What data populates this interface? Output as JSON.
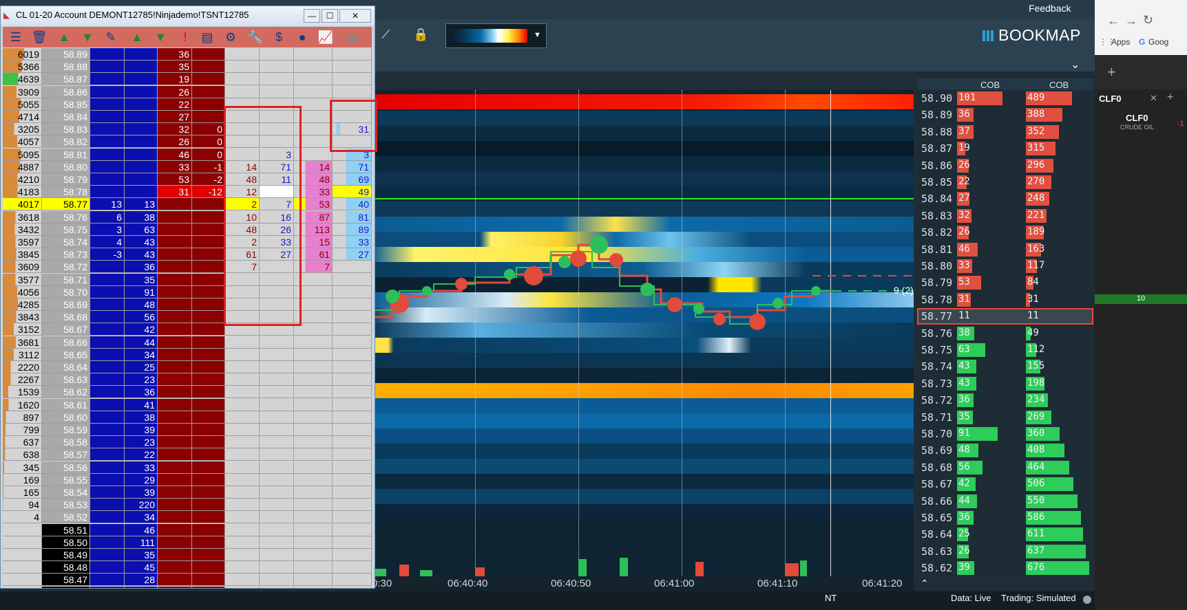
{
  "bookmap": {
    "feedback": "Feedback",
    "logo": "BOOKMAP",
    "cob_headers": [
      "COB",
      "COB"
    ],
    "time_labels": [
      "0:30",
      "06:40:40",
      "06:40:50",
      "06:41:00",
      "06:41:10",
      "06:41:20"
    ],
    "nt_label": "NT",
    "status_data": "Data: Live",
    "status_trading": "Trading: Simulated",
    "marker_text": "9 (2)",
    "current_price": "58.77",
    "ladder": [
      {
        "price": "58.90",
        "v1": "101",
        "v2": "489",
        "side": "ask"
      },
      {
        "price": "58.89",
        "v1": "36",
        "v2": "388",
        "side": "ask"
      },
      {
        "price": "58.88",
        "v1": "37",
        "v2": "352",
        "side": "ask"
      },
      {
        "price": "58.87",
        "v1": "19",
        "v2": "315",
        "side": "ask"
      },
      {
        "price": "58.86",
        "v1": "26",
        "v2": "296",
        "side": "ask"
      },
      {
        "price": "58.85",
        "v1": "22",
        "v2": "270",
        "side": "ask"
      },
      {
        "price": "58.84",
        "v1": "27",
        "v2": "248",
        "side": "ask"
      },
      {
        "price": "58.83",
        "v1": "32",
        "v2": "221",
        "side": "ask"
      },
      {
        "price": "58.82",
        "v1": "26",
        "v2": "189",
        "side": "ask"
      },
      {
        "price": "58.81",
        "v1": "46",
        "v2": "163",
        "side": "ask"
      },
      {
        "price": "58.80",
        "v1": "33",
        "v2": "117",
        "side": "ask"
      },
      {
        "price": "58.79",
        "v1": "53",
        "v2": "84",
        "side": "ask"
      },
      {
        "price": "58.78",
        "v1": "31",
        "v2": "31",
        "side": "ask"
      },
      {
        "price": "58.77",
        "v1": "11",
        "v2": "11",
        "side": "mid"
      },
      {
        "price": "58.76",
        "v1": "38",
        "v2": "49",
        "side": "bid"
      },
      {
        "price": "58.75",
        "v1": "63",
        "v2": "112",
        "side": "bid"
      },
      {
        "price": "58.74",
        "v1": "43",
        "v2": "155",
        "side": "bid"
      },
      {
        "price": "58.73",
        "v1": "43",
        "v2": "198",
        "side": "bid"
      },
      {
        "price": "58.72",
        "v1": "36",
        "v2": "234",
        "side": "bid"
      },
      {
        "price": "58.71",
        "v1": "35",
        "v2": "269",
        "side": "bid"
      },
      {
        "price": "58.70",
        "v1": "91",
        "v2": "360",
        "side": "bid"
      },
      {
        "price": "58.69",
        "v1": "48",
        "v2": "408",
        "side": "bid"
      },
      {
        "price": "58.68",
        "v1": "56",
        "v2": "464",
        "side": "bid"
      },
      {
        "price": "58.67",
        "v1": "42",
        "v2": "506",
        "side": "bid"
      },
      {
        "price": "58.66",
        "v1": "44",
        "v2": "550",
        "side": "bid"
      },
      {
        "price": "58.65",
        "v1": "36",
        "v2": "586",
        "side": "bid"
      },
      {
        "price": "58.64",
        "v1": "25",
        "v2": "611",
        "side": "bid"
      },
      {
        "price": "58.63",
        "v1": "26",
        "v2": "637",
        "side": "bid"
      },
      {
        "price": "58.62",
        "v1": "39",
        "v2": "676",
        "side": "bid"
      }
    ]
  },
  "browser": {
    "apps": "Apps",
    "google": "Goog",
    "tab_name": "CLF0",
    "symbol": "CLF0",
    "symbol_sub": "CRUDE OIL",
    "badge": "10",
    "change": "-1"
  },
  "nt": {
    "title": "CL 01-20  Account DEMONT12785!Ninjademo!TSNT12785",
    "rows": [
      {
        "v": "6019",
        "p": "58.89",
        "b1": "",
        "b2": "",
        "a1": "36",
        "a2": "",
        "x1": "",
        "x2": "",
        "x3": "",
        "x4": ""
      },
      {
        "v": "5366",
        "p": "58.88",
        "b1": "",
        "b2": "",
        "a1": "35",
        "a2": "",
        "x1": "",
        "x2": "",
        "x3": "",
        "x4": ""
      },
      {
        "v": "4639",
        "p": "58.87",
        "b1": "",
        "b2": "",
        "a1": "19",
        "a2": "",
        "x1": "",
        "x2": "",
        "x3": "",
        "x4": ""
      },
      {
        "v": "3909",
        "p": "58.86",
        "b1": "",
        "b2": "",
        "a1": "26",
        "a2": "",
        "x1": "",
        "x2": "",
        "x3": "",
        "x4": ""
      },
      {
        "v": "5055",
        "p": "58.85",
        "b1": "",
        "b2": "",
        "a1": "22",
        "a2": "",
        "x1": "",
        "x2": "",
        "x3": "",
        "x4": ""
      },
      {
        "v": "4714",
        "p": "58.84",
        "b1": "",
        "b2": "",
        "a1": "27",
        "a2": "",
        "x1": "",
        "x2": "",
        "x3": "",
        "x4": ""
      },
      {
        "v": "3205",
        "p": "58.83",
        "b1": "",
        "b2": "",
        "a1": "32",
        "a2": "0",
        "x1": "",
        "x2": "",
        "x3": "",
        "x4": "31"
      },
      {
        "v": "4057",
        "p": "58.82",
        "b1": "",
        "b2": "",
        "a1": "26",
        "a2": "0",
        "x1": "",
        "x2": "",
        "x3": "",
        "x4": ""
      },
      {
        "v": "5095",
        "p": "58.81",
        "b1": "",
        "b2": "",
        "a1": "46",
        "a2": "0",
        "x1": "",
        "x2": "3",
        "x3": "",
        "x4": "3"
      },
      {
        "v": "4887",
        "p": "58.80",
        "b1": "",
        "b2": "",
        "a1": "33",
        "a2": "-1",
        "x1": "14",
        "x2": "71",
        "x3": "14",
        "x4": "71"
      },
      {
        "v": "4210",
        "p": "58.79",
        "b1": "",
        "b2": "",
        "a1": "53",
        "a2": "-2",
        "x1": "48",
        "x2": "11",
        "x3": "48",
        "x4": "69"
      },
      {
        "v": "4183",
        "p": "58.78",
        "b1": "",
        "b2": "",
        "a1": "31",
        "a2": "-12",
        "x1": "12",
        "x2": "",
        "x3": "33",
        "x4": "49"
      },
      {
        "v": "4017",
        "p": "58.77",
        "b1": "13",
        "b2": "13",
        "a1": "",
        "a2": "",
        "x1": "2",
        "x2": "7",
        "x3": "53",
        "x4": "40"
      },
      {
        "v": "3618",
        "p": "58.76",
        "b1": "6",
        "b2": "38",
        "a1": "",
        "a2": "",
        "x1": "10",
        "x2": "16",
        "x3": "87",
        "x4": "81"
      },
      {
        "v": "3432",
        "p": "58.75",
        "b1": "3",
        "b2": "63",
        "a1": "",
        "a2": "",
        "x1": "48",
        "x2": "26",
        "x3": "113",
        "x4": "89"
      },
      {
        "v": "3597",
        "p": "58.74",
        "b1": "4",
        "b2": "43",
        "a1": "",
        "a2": "",
        "x1": "2",
        "x2": "33",
        "x3": "15",
        "x4": "33"
      },
      {
        "v": "3845",
        "p": "58.73",
        "b1": "-3",
        "b2": "43",
        "a1": "",
        "a2": "",
        "x1": "61",
        "x2": "27",
        "x3": "61",
        "x4": "27"
      },
      {
        "v": "3609",
        "p": "58.72",
        "b1": "",
        "b2": "36",
        "a1": "",
        "a2": "",
        "x1": "7",
        "x2": "",
        "x3": "7",
        "x4": ""
      },
      {
        "v": "3577",
        "p": "58.71",
        "b1": "",
        "b2": "35",
        "a1": "",
        "a2": "",
        "x1": "",
        "x2": "",
        "x3": "",
        "x4": ""
      },
      {
        "v": "4056",
        "p": "58.70",
        "b1": "",
        "b2": "91",
        "a1": "",
        "a2": "",
        "x1": "",
        "x2": "",
        "x3": "",
        "x4": ""
      },
      {
        "v": "4285",
        "p": "58.69",
        "b1": "",
        "b2": "48",
        "a1": "",
        "a2": "",
        "x1": "",
        "x2": "",
        "x3": "",
        "x4": ""
      },
      {
        "v": "3843",
        "p": "58.68",
        "b1": "",
        "b2": "56",
        "a1": "",
        "a2": "",
        "x1": "",
        "x2": "",
        "x3": "",
        "x4": ""
      },
      {
        "v": "3152",
        "p": "58.67",
        "b1": "",
        "b2": "42",
        "a1": "",
        "a2": "",
        "x1": "",
        "x2": "",
        "x3": "",
        "x4": ""
      },
      {
        "v": "3681",
        "p": "58.66",
        "b1": "",
        "b2": "44",
        "a1": "",
        "a2": "",
        "x1": "",
        "x2": "",
        "x3": "",
        "x4": ""
      },
      {
        "v": "3112",
        "p": "58.65",
        "b1": "",
        "b2": "34",
        "a1": "",
        "a2": "",
        "x1": "",
        "x2": "",
        "x3": "",
        "x4": ""
      },
      {
        "v": "2220",
        "p": "58.64",
        "b1": "",
        "b2": "25",
        "a1": "",
        "a2": "",
        "x1": "",
        "x2": "",
        "x3": "",
        "x4": ""
      },
      {
        "v": "2267",
        "p": "58.63",
        "b1": "",
        "b2": "23",
        "a1": "",
        "a2": "",
        "x1": "",
        "x2": "",
        "x3": "",
        "x4": ""
      },
      {
        "v": "1539",
        "p": "58.62",
        "b1": "",
        "b2": "36",
        "a1": "",
        "a2": "",
        "x1": "",
        "x2": "",
        "x3": "",
        "x4": ""
      },
      {
        "v": "1620",
        "p": "58.61",
        "b1": "",
        "b2": "41",
        "a1": "",
        "a2": "",
        "x1": "",
        "x2": "",
        "x3": "",
        "x4": ""
      },
      {
        "v": "897",
        "p": "58.60",
        "b1": "",
        "b2": "38",
        "a1": "",
        "a2": "",
        "x1": "",
        "x2": "",
        "x3": "",
        "x4": ""
      },
      {
        "v": "799",
        "p": "58.59",
        "b1": "",
        "b2": "39",
        "a1": "",
        "a2": "",
        "x1": "",
        "x2": "",
        "x3": "",
        "x4": ""
      },
      {
        "v": "637",
        "p": "58.58",
        "b1": "",
        "b2": "23",
        "a1": "",
        "a2": "",
        "x1": "",
        "x2": "",
        "x3": "",
        "x4": ""
      },
      {
        "v": "638",
        "p": "58.57",
        "b1": "",
        "b2": "22",
        "a1": "",
        "a2": "",
        "x1": "",
        "x2": "",
        "x3": "",
        "x4": ""
      },
      {
        "v": "345",
        "p": "58.56",
        "b1": "",
        "b2": "33",
        "a1": "",
        "a2": "",
        "x1": "",
        "x2": "",
        "x3": "",
        "x4": ""
      },
      {
        "v": "169",
        "p": "58.55",
        "b1": "",
        "b2": "29",
        "a1": "",
        "a2": "",
        "x1": "",
        "x2": "",
        "x3": "",
        "x4": ""
      },
      {
        "v": "165",
        "p": "58.54",
        "b1": "",
        "b2": "39",
        "a1": "",
        "a2": "",
        "x1": "",
        "x2": "",
        "x3": "",
        "x4": ""
      },
      {
        "v": "94",
        "p": "58.53",
        "b1": "",
        "b2": "220",
        "a1": "",
        "a2": "",
        "x1": "",
        "x2": "",
        "x3": "",
        "x4": ""
      },
      {
        "v": "4",
        "p": "58.52",
        "b1": "",
        "b2": "34",
        "a1": "",
        "a2": "",
        "x1": "",
        "x2": "",
        "x3": "",
        "x4": ""
      },
      {
        "v": "",
        "p": "58.51",
        "b1": "",
        "b2": "46",
        "a1": "",
        "a2": "",
        "x1": "",
        "x2": "",
        "x3": "",
        "x4": ""
      },
      {
        "v": "",
        "p": "58.50",
        "b1": "",
        "b2": "111",
        "a1": "",
        "a2": "",
        "x1": "",
        "x2": "",
        "x3": "",
        "x4": ""
      },
      {
        "v": "",
        "p": "58.49",
        "b1": "",
        "b2": "35",
        "a1": "",
        "a2": "",
        "x1": "",
        "x2": "",
        "x3": "",
        "x4": ""
      },
      {
        "v": "",
        "p": "58.48",
        "b1": "",
        "b2": "45",
        "a1": "",
        "a2": "",
        "x1": "",
        "x2": "",
        "x3": "",
        "x4": ""
      },
      {
        "v": "",
        "p": "58.47",
        "b1": "",
        "b2": "28",
        "a1": "",
        "a2": "",
        "x1": "",
        "x2": "",
        "x3": "",
        "x4": ""
      },
      {
        "v": "",
        "p": "58.46",
        "b1": "",
        "b2": "44",
        "a1": "",
        "a2": "",
        "x1": "",
        "x2": "",
        "x3": "",
        "x4": ""
      }
    ]
  }
}
